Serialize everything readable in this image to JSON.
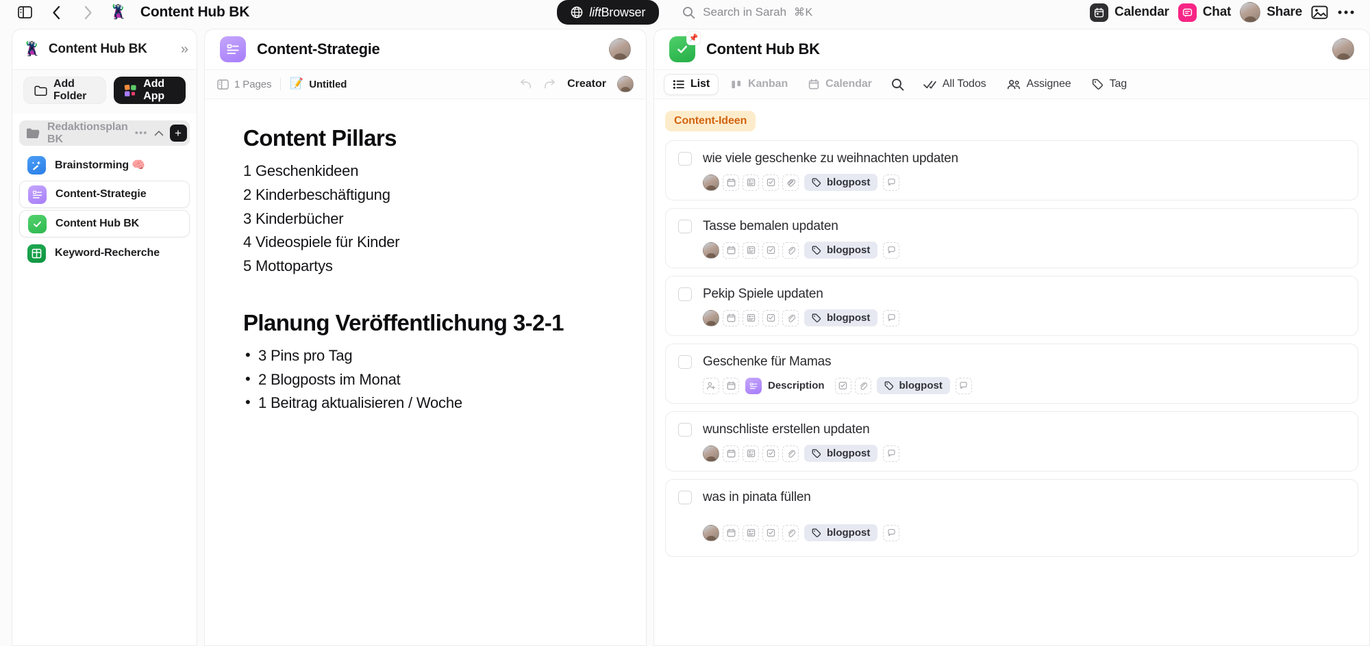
{
  "topbar": {
    "sidebar_toggle_icon": "sidebar-toggle-icon",
    "back_icon": "chevron-left-icon",
    "forward_icon": "chevron-right-icon",
    "workspace_emoji": "🦹",
    "title": "Content Hub BK",
    "browser_pill": {
      "icon": "globe-icon",
      "italic": "lift",
      "bold": "Browser"
    },
    "search": {
      "icon": "search-icon",
      "placeholder": "Search in Sarah",
      "shortcut": "⌘K"
    },
    "right_items": [
      {
        "label": "Calendar",
        "icon": "calendar-icon"
      },
      {
        "label": "Chat",
        "icon": "chat-icon"
      },
      {
        "label": "Share",
        "icon": "avatar"
      }
    ],
    "image_icon": "image-icon",
    "more_icon": "more-horizontal-icon"
  },
  "sidebar": {
    "emoji": "🦹",
    "title": "Content Hub BK",
    "collapse_icon": "chevron-double-right-icon",
    "add_folder_label": "Add Folder",
    "add_folder_icon": "folder-icon",
    "add_app_label": "Add App",
    "add_app_icon": "apps-grid-icon",
    "folder": {
      "name": "Redaktionsplan BK",
      "icon": "folder-open-icon",
      "more_icon": "more-horizontal-icon",
      "collapse_icon": "chevron-up-icon",
      "add_icon": "plus-icon"
    },
    "apps": [
      {
        "label": "Brainstorming 🧠",
        "icon": "sparkle-wand-icon",
        "color": "blue",
        "selected": false
      },
      {
        "label": "Content-Strategie",
        "icon": "doc-lines-icon",
        "color": "purple",
        "selected": true
      },
      {
        "label": "Content Hub BK",
        "icon": "check-icon",
        "color": "green",
        "selected": true
      },
      {
        "label": "Keyword-Recherche",
        "icon": "table-icon",
        "color": "darkgreen",
        "selected": false
      }
    ]
  },
  "document": {
    "app_icon": "doc-lines-icon",
    "title": "Content-Strategie",
    "subbar": {
      "pages_icon": "pages-icon",
      "pages_label": "1 Pages",
      "note_icon": "notepad-icon",
      "note_label": "Untitled",
      "undo_icon": "undo-icon",
      "redo_icon": "redo-icon",
      "creator_label": "Creator"
    },
    "heading1": "Content Pillars",
    "pillars": [
      "1 Geschenkideen",
      "2 Kinderbeschäftigung",
      "3 Kinderbücher",
      "4 Videospiele für Kinder",
      "5 Mottopartys"
    ],
    "heading2": "Planung Veröffentlichung 3-2-1",
    "bullets": [
      "3 Pins pro Tag",
      "2 Blogposts im Monat",
      "1 Beitrag aktualisieren / Woche"
    ]
  },
  "tasks": {
    "app_icon": "check-icon",
    "pin_icon": "📌",
    "title": "Content Hub BK",
    "tabs": [
      {
        "label": "List",
        "icon": "list-icon",
        "state": "active"
      },
      {
        "label": "Kanban",
        "icon": "kanban-icon",
        "state": "muted"
      },
      {
        "label": "Calendar",
        "icon": "calendar-icon",
        "state": "muted"
      },
      {
        "label": "",
        "icon": "search-icon",
        "state": "icon-only"
      },
      {
        "label": "All Todos",
        "icon": "double-check-icon",
        "state": "plain"
      },
      {
        "label": "Assignee",
        "icon": "people-icon",
        "state": "plain"
      },
      {
        "label": "Tag",
        "icon": "tag-icon",
        "state": "plain"
      }
    ],
    "group_label": "Content-Ideen",
    "tag_label": "blogpost",
    "description_label": "Description",
    "items": [
      {
        "title": "wie viele geschenke zu weihnachten updaten",
        "has_avatar": true,
        "has_description": false,
        "tall": false
      },
      {
        "title": "Tasse bemalen updaten",
        "has_avatar": true,
        "has_description": false,
        "tall": false
      },
      {
        "title": "Pekip Spiele updaten",
        "has_avatar": true,
        "has_description": false,
        "tall": false
      },
      {
        "title": "Geschenke für Mamas",
        "has_avatar": false,
        "has_description": true,
        "tall": false
      },
      {
        "title": "wunschliste erstellen updaten",
        "has_avatar": true,
        "has_description": false,
        "tall": false
      },
      {
        "title": "was in pinata füllen",
        "has_avatar": true,
        "has_description": false,
        "tall": true
      }
    ]
  },
  "colors": {
    "accent_green": "#2eb84e",
    "accent_purple": "#a77dfa",
    "chat_pink": "#f72585",
    "group_chip_bg": "#fdeccb",
    "group_chip_fg": "#d2640f",
    "tag_chip_bg": "#e7e9f2"
  }
}
